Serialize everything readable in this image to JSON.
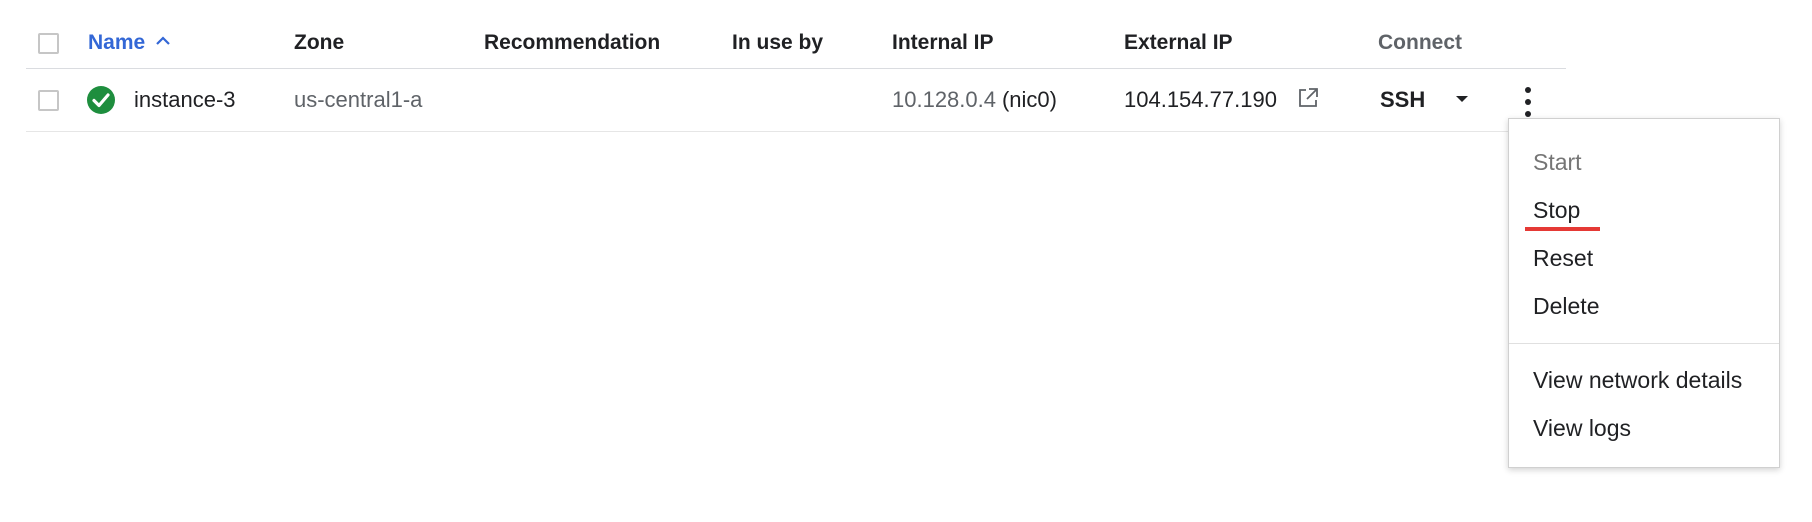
{
  "table": {
    "headers": {
      "name": "Name",
      "zone": "Zone",
      "recommendation": "Recommendation",
      "in_use_by": "In use by",
      "internal_ip": "Internal IP",
      "external_ip": "External IP",
      "connect": "Connect"
    },
    "sort": {
      "column": "Name",
      "direction": "ascending",
      "icon": "chevron-up-icon"
    },
    "rows": [
      {
        "status": "running",
        "status_icon": "check-circle-icon",
        "status_color": "#1e8e3e",
        "name": "instance-3",
        "zone": "us-central1-a",
        "recommendation": "",
        "in_use_by": "",
        "internal_ip": "10.128.0.4",
        "internal_ip_nic": "(nic0)",
        "external_ip": "104.154.77.190",
        "external_ip_icon": "external-link-icon",
        "connect_label": "SSH",
        "connect_dropdown_icon": "caret-down-icon",
        "more_icon": "more-vert-icon"
      }
    ]
  },
  "context_menu": {
    "items": [
      {
        "label": "Start",
        "enabled": false
      },
      {
        "label": "Stop",
        "enabled": true,
        "highlighted": true
      },
      {
        "label": "Reset",
        "enabled": true
      },
      {
        "label": "Delete",
        "enabled": true
      },
      {
        "label": "View network details",
        "enabled": true
      },
      {
        "label": "View logs",
        "enabled": true
      }
    ],
    "highlight_color": "#e53935"
  },
  "colors": {
    "sorted_header": "#3367d6",
    "status_green": "#1e8e3e"
  }
}
